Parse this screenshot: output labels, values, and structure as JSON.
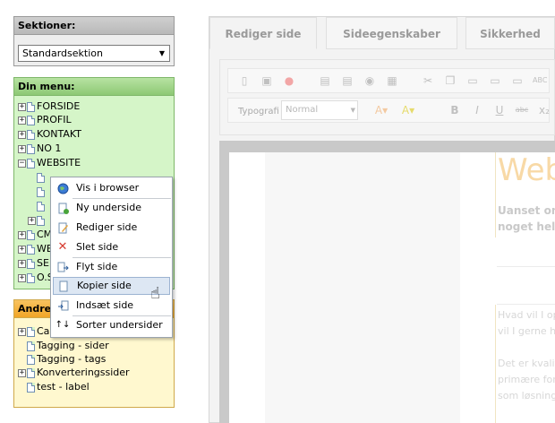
{
  "sidebar": {
    "sections_title": "Sektioner:",
    "sections_selected": "Standardsektion",
    "menu_title": "Din menu:",
    "menu_items": [
      "FORSIDE",
      "PROFIL",
      "KONTAKT",
      "NO 1",
      "WEBSITE",
      "CM",
      "WE",
      "SE",
      "O.S"
    ],
    "other_title": "Andre",
    "other_items": [
      "Ca",
      "Tagging - sider",
      "Tagging - tags",
      "Konverteringssider",
      "test - label"
    ]
  },
  "context_menu": {
    "items": [
      {
        "label": "Vis i browser",
        "icon": "globe-icon"
      },
      {
        "label": "Ny underside",
        "icon": "new-page-icon"
      },
      {
        "label": "Rediger side",
        "icon": "edit-page-icon"
      },
      {
        "label": "Slet side",
        "icon": "delete-icon"
      },
      {
        "label": "Flyt side",
        "icon": "move-page-icon"
      },
      {
        "label": "Kopier side",
        "icon": "copy-page-icon"
      },
      {
        "label": "Indsæt side",
        "icon": "insert-page-icon"
      },
      {
        "label": "Sorter undersider",
        "icon": "sort-icon"
      }
    ],
    "hovered_item": "Kopier side"
  },
  "editor": {
    "tabs": [
      "Rediger side",
      "Sideegenskaber",
      "Sikkerhed"
    ],
    "active_tab": "Rediger side",
    "font_label": "Typografi",
    "style_select": "Normal",
    "doc_heading": "Web",
    "doc_subtext_1": "Uanset om",
    "doc_subtext_2": "noget helt",
    "doc_text_1": "Hvad vil I op",
    "doc_text_2": "vil I gerne ha",
    "doc_text_3": "Det er kvalit",
    "doc_text_4": "primære for",
    "doc_text_5": "som løsning"
  },
  "colors": {
    "menu_panel_bg": "#d5f5c8",
    "other_panel_bg": "#fff8cf",
    "hover_bg": "#dde7f3",
    "heading_color": "#f8d9a6"
  }
}
